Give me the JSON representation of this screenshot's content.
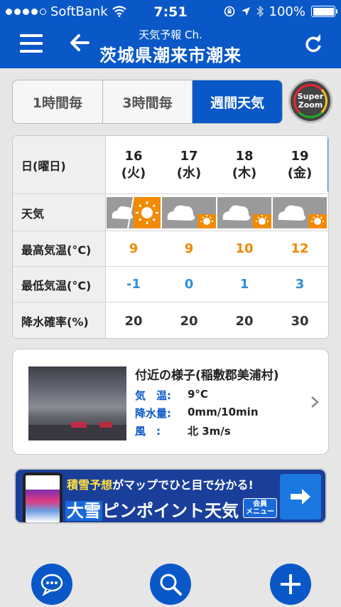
{
  "statusbar": {
    "carrier": "SoftBank",
    "time": "7:51",
    "battery": "100%"
  },
  "header": {
    "subtitle": "天気予報 Ch.",
    "title": "茨城県潮来市潮来"
  },
  "tabs": [
    {
      "label": "1時間毎",
      "active": false
    },
    {
      "label": "3時間毎",
      "active": false
    },
    {
      "label": "週間天気",
      "active": true
    }
  ],
  "superzoom": {
    "line1": "Super",
    "line2": "Zoom"
  },
  "forecast": {
    "row_labels": {
      "date": "日(曜日)",
      "weather": "天気",
      "high": "最高気温(°C)",
      "low": "最低気温(°C)",
      "precip": "降水確率(%)"
    },
    "days": [
      {
        "day": "16",
        "dow": "(火)",
        "weather": "cloudy-then-sunny",
        "high": "9",
        "low": "-1",
        "precip": "20"
      },
      {
        "day": "17",
        "dow": "(水)",
        "weather": "cloudy-sometimes-sunny",
        "high": "9",
        "low": "0",
        "precip": "20"
      },
      {
        "day": "18",
        "dow": "(木)",
        "weather": "cloudy-sometimes-sunny",
        "high": "10",
        "low": "1",
        "precip": "20"
      },
      {
        "day": "19",
        "dow": "(金)",
        "weather": "cloudy-sometimes-sunny",
        "high": "12",
        "low": "3",
        "precip": "30"
      }
    ]
  },
  "nearby": {
    "title": "付近の様子(稲敷郡美浦村)",
    "rows": [
      {
        "label": "気　温:",
        "value": "9°C"
      },
      {
        "label": "降水量:",
        "value": "0mm/10min"
      },
      {
        "label": "風　:",
        "value": "北 3m/s"
      }
    ]
  },
  "banner": {
    "top_highlight": "積雪予想",
    "top_rest": "がマップでひと目で分かる!",
    "main_highlight": "大雪",
    "main_rest": "ピンポイント天気",
    "member_line1": "会員",
    "member_line2": "メニュー"
  },
  "colors": {
    "brand_blue": "#0a58c8",
    "high_temp": "#f08a00",
    "low_temp": "#2f8fd8"
  }
}
